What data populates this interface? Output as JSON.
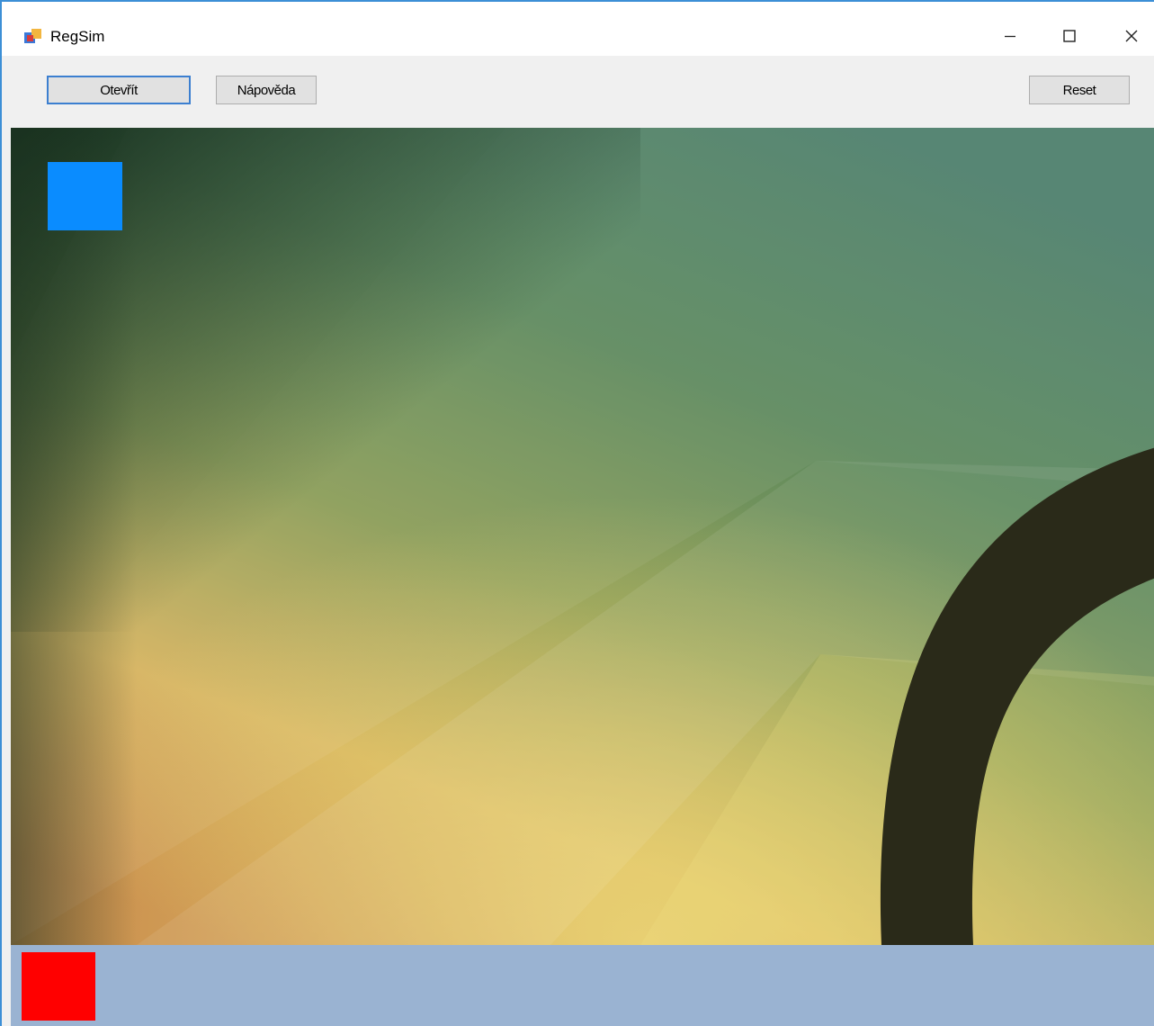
{
  "window": {
    "title": "RegSim",
    "controls": {
      "minimize_icon": "minimize-icon",
      "maximize_icon": "maximize-icon",
      "close_icon": "close-icon"
    }
  },
  "toolbar": {
    "open_label": "Otevřít",
    "help_label": "Nápověda",
    "reset_label": "Reset"
  },
  "scene": {
    "start_marker_color": "#0a8cff",
    "track_color": "#2a2a19"
  },
  "status": {
    "indicator_color": "#ff0000",
    "bar_color": "#9ab3d2"
  }
}
